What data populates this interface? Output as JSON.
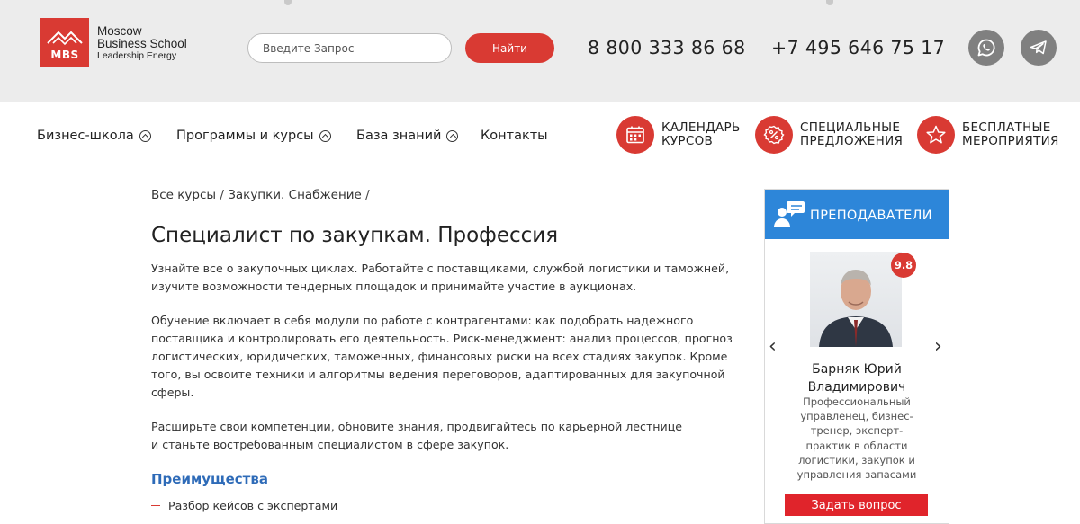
{
  "header": {
    "logo": {
      "mark": "MBS",
      "line1": "Moscow",
      "line2": "Business School",
      "line3": "Leadership Energy"
    },
    "search": {
      "placeholder": "Введите Запрос",
      "button_label": "Найти"
    },
    "phones": [
      "8 800 333 86 68",
      "+7 495 646 75 17"
    ],
    "social": [
      {
        "icon": "whatsapp-icon"
      },
      {
        "icon": "telegram-icon"
      }
    ]
  },
  "nav": {
    "items": [
      {
        "label": "Бизнес-школа",
        "has_dropdown": true
      },
      {
        "label": "Программы и курсы",
        "has_dropdown": true
      },
      {
        "label": "База знаний",
        "has_dropdown": true
      },
      {
        "label": "Контакты",
        "has_dropdown": false
      }
    ],
    "quick_links": [
      {
        "line1": "КАЛЕНДАРЬ",
        "line2": "КУРСОВ",
        "icon": "calendar-icon"
      },
      {
        "line1": "СПЕЦИАЛЬНЫЕ",
        "line2": "ПРЕДЛОЖЕНИЯ",
        "icon": "percent-badge-icon"
      },
      {
        "line1": "БЕСПЛАТНЫЕ",
        "line2": "МЕРОПРИЯТИЯ",
        "icon": "star-icon"
      }
    ]
  },
  "breadcrumb": {
    "items": [
      "Все курсы",
      "Закупки. Снабжение"
    ],
    "separator": "/"
  },
  "main": {
    "title": "Специалист по закупкам. Профессия",
    "paragraphs": [
      [
        "Узнайте все о закупочных циклах. Работайте с поставщиками, службой логистики и таможней,",
        "изучите возможности тендерных площадок и принимайте участие в аукционах."
      ],
      [
        "Обучение включает в себя модули по работе с контрагентами: как подобрать надежного",
        "поставщика и контролировать его деятельность. Риск-менеджмент: анализ процессов, прогноз",
        "логистических, юридических, таможенных, финансовых риски на всех стадиях закупок. Кроме",
        "того, вы освоите техники и алгоритмы ведения переговоров, адаптированных для закупочной",
        "сферы."
      ],
      [
        "Расширьте свои компетенции, обновите знания, продвигайтесь по карьерной лестнице",
        "и станьте востребованным специалистом в сфере закупок."
      ]
    ],
    "advantages_title": "Преимущества",
    "advantages": [
      "Разбор кейсов с экспертами"
    ]
  },
  "teachers": {
    "title": "ПРЕПОДАВАТЕЛИ",
    "rating": "9.8",
    "name_line1": "Барняк Юрий",
    "name_line2": "Владимирович",
    "description": [
      "Профессиональный",
      "управленец, бизнес-",
      "тренер, эксперт-",
      "практик в области",
      "логистики, закупок и",
      "управления запасами"
    ],
    "prev": "‹",
    "next": "›",
    "ask_button": "Задать вопрос"
  },
  "colors": {
    "brand_red": "#d93a33",
    "header_bg": "#ececec",
    "accent_blue": "#2d86d9",
    "link_blue": "#2e6bb8"
  }
}
